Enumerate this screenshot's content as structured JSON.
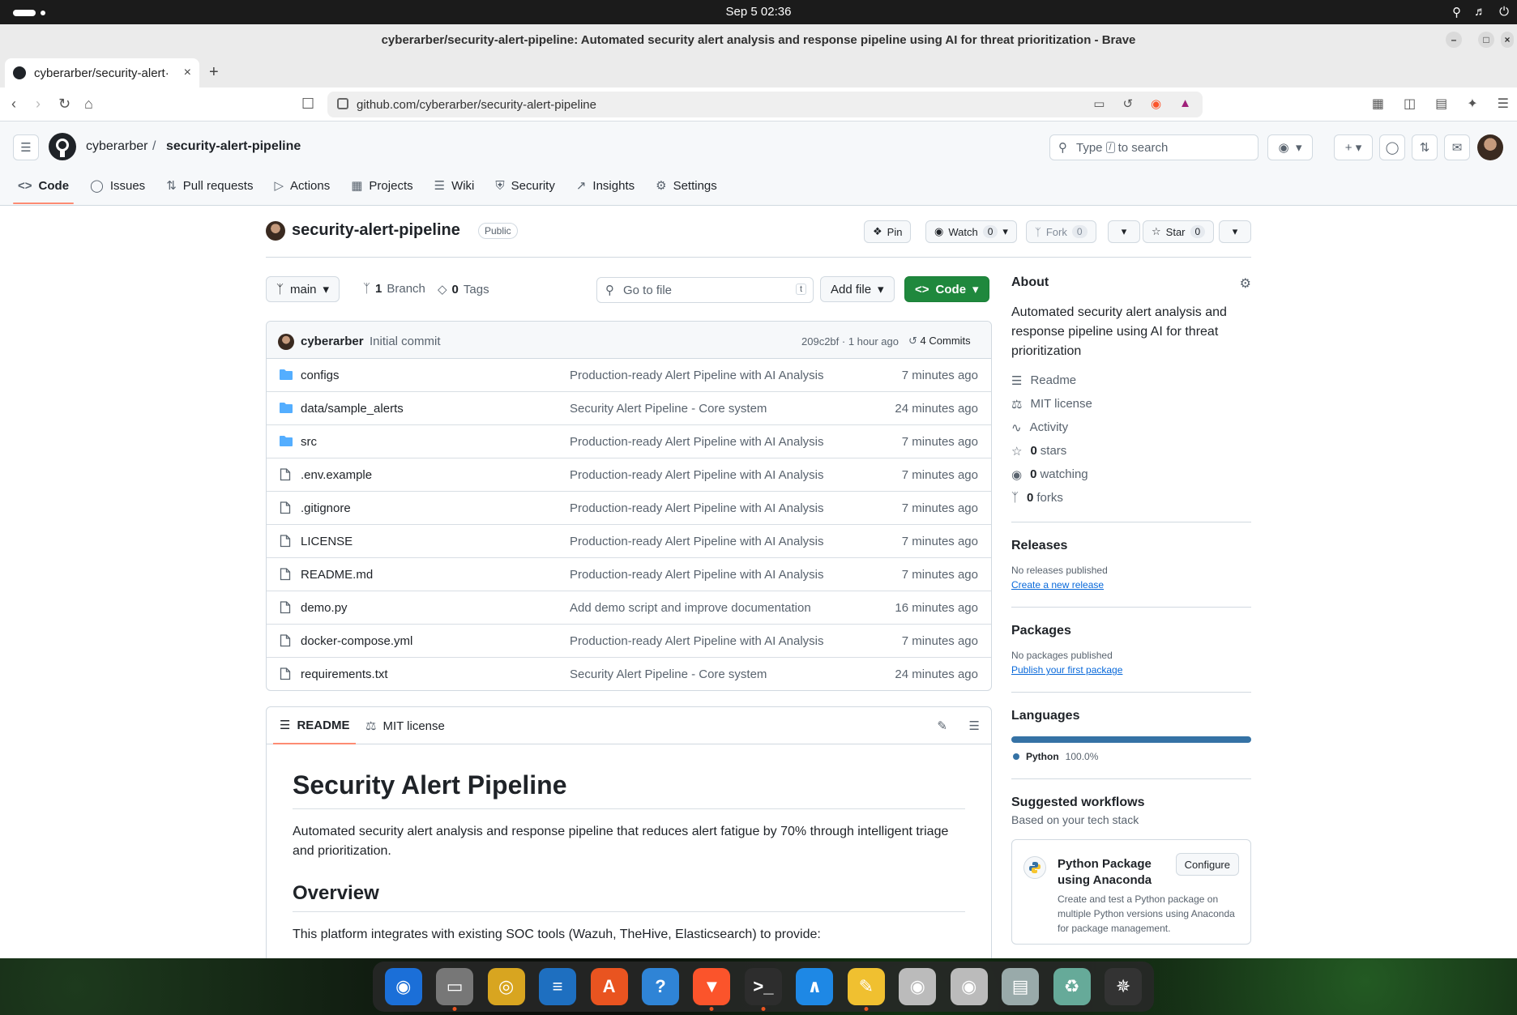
{
  "os": {
    "clock": "Sep 5  02:36"
  },
  "window": {
    "title": "cyberarber/security-alert-pipeline: Automated security alert analysis and response pipeline using AI for threat prioritization - Brave"
  },
  "browser": {
    "tab_title": "cyberarber/security-alert·",
    "url": "github.com/cyberarber/security-alert-pipeline"
  },
  "github": {
    "owner": "cyberarber",
    "repo": "security-alert-pipeline",
    "search_placeholder_pre": "Type",
    "search_key": "/",
    "search_placeholder_post": "to search",
    "tabs": [
      {
        "label": "Code",
        "icon": "code-icon"
      },
      {
        "label": "Issues",
        "icon": "issue-icon"
      },
      {
        "label": "Pull requests",
        "icon": "pull-request-icon"
      },
      {
        "label": "Actions",
        "icon": "play-icon"
      },
      {
        "label": "Projects",
        "icon": "table-icon"
      },
      {
        "label": "Wiki",
        "icon": "book-icon"
      },
      {
        "label": "Security",
        "icon": "shield-icon"
      },
      {
        "label": "Insights",
        "icon": "graph-icon"
      },
      {
        "label": "Settings",
        "icon": "gear-icon"
      }
    ]
  },
  "repo_header": {
    "name": "security-alert-pipeline",
    "visibility": "Public",
    "pin": "Pin",
    "watch": "Watch",
    "watch_count": "0",
    "fork": "Fork",
    "fork_count": "0",
    "star": "Star",
    "star_count": "0"
  },
  "toolbar": {
    "branch": "main",
    "branch_count": "1",
    "branch_label": "Branch",
    "tag_count": "0",
    "tag_label": "Tags",
    "go_to_file": "Go to file",
    "go_to_file_key": "t",
    "add_file": "Add file",
    "code": "Code"
  },
  "commit": {
    "author": "cyberarber",
    "message": "Initial commit",
    "meta": "209c2bf · 1 hour ago",
    "commits": "4 Commits"
  },
  "files": [
    {
      "name": "configs",
      "type": "dir",
      "message": "Production-ready Alert Pipeline with AI Analysis",
      "time": "7 minutes ago"
    },
    {
      "name": "data/sample_alerts",
      "type": "dir",
      "message": "Security Alert Pipeline - Core system",
      "time": "24 minutes ago"
    },
    {
      "name": "src",
      "type": "dir",
      "message": "Production-ready Alert Pipeline with AI Analysis",
      "time": "7 minutes ago"
    },
    {
      "name": ".env.example",
      "type": "file",
      "message": "Production-ready Alert Pipeline with AI Analysis",
      "time": "7 minutes ago"
    },
    {
      "name": ".gitignore",
      "type": "file",
      "message": "Production-ready Alert Pipeline with AI Analysis",
      "time": "7 minutes ago"
    },
    {
      "name": "LICENSE",
      "type": "file",
      "message": "Production-ready Alert Pipeline with AI Analysis",
      "time": "7 minutes ago"
    },
    {
      "name": "README.md",
      "type": "file",
      "message": "Production-ready Alert Pipeline with AI Analysis",
      "time": "7 minutes ago"
    },
    {
      "name": "demo.py",
      "type": "file",
      "message": "Add demo script and improve documentation",
      "time": "16 minutes ago"
    },
    {
      "name": "docker-compose.yml",
      "type": "file",
      "message": "Production-ready Alert Pipeline with AI Analysis",
      "time": "7 minutes ago"
    },
    {
      "name": "requirements.txt",
      "type": "file",
      "message": "Security Alert Pipeline - Core system",
      "time": "24 minutes ago"
    }
  ],
  "readme": {
    "tab_readme": "README",
    "tab_license": "MIT license",
    "h1": "Security Alert Pipeline",
    "intro": "Automated security alert analysis and response pipeline that reduces alert fatigue by 70% through intelligent triage and prioritization.",
    "h2": "Overview",
    "p2": "This platform integrates with existing SOC tools (Wazuh, TheHive, Elasticsearch) to provide:"
  },
  "sidebar": {
    "about_title": "About",
    "description": "Automated security alert analysis and response pipeline using AI for threat prioritization",
    "readme": "Readme",
    "license": "MIT license",
    "activity": "Activity",
    "stars_count": "0",
    "stars_label": "stars",
    "watching_count": "0",
    "watching_label": "watching",
    "forks_count": "0",
    "forks_label": "forks",
    "releases_title": "Releases",
    "no_releases": "No releases published",
    "create_release": "Create a new release",
    "packages_title": "Packages",
    "no_packages": "No packages published",
    "publish_package": "Publish your first package",
    "languages_title": "Languages",
    "language": "Python",
    "language_pct": "100.0%",
    "language_color": "#3572A5",
    "workflows_title": "Suggested workflows",
    "workflows_sub": "Based on your tech stack",
    "workflow_name": "Python Package using Anaconda",
    "workflow_button": "Configure",
    "workflow_desc": "Create and test a Python package on multiple Python versions using Anaconda for package management."
  },
  "dock": [
    "thunderbird-icon",
    "files-icon",
    "rhythmbox-icon",
    "writer-icon",
    "app-center-icon",
    "help-icon",
    "brave-icon",
    "terminal-icon",
    "vscode-icon",
    "text-editor-icon",
    "disc-icon",
    "disc-icon-2",
    "disk-image-icon",
    "trash-icon",
    "ubuntu-icon"
  ],
  "colors": {
    "accent": "#fd8c73",
    "green": "#1f883d",
    "link": "#0969da"
  }
}
